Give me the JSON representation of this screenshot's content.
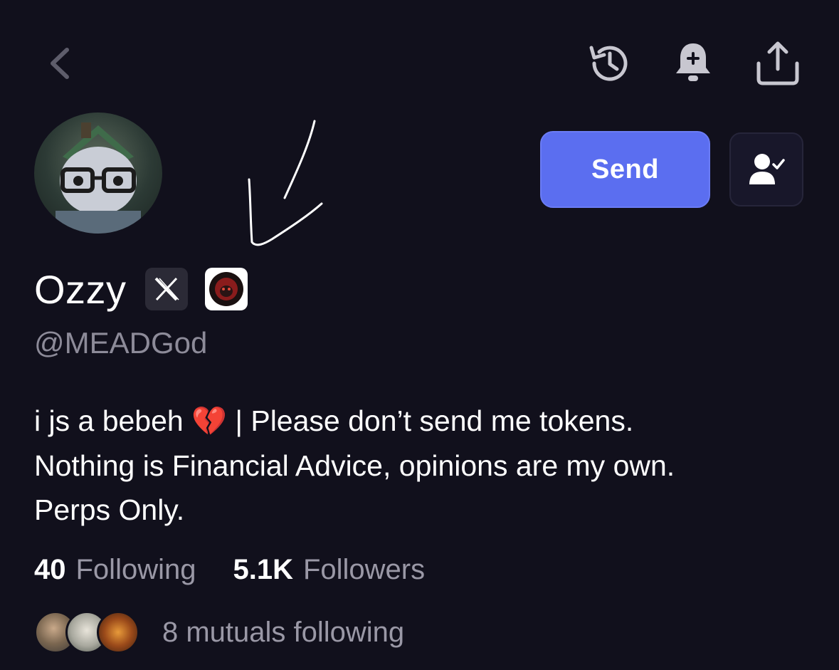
{
  "header": {
    "icons": [
      "back-chevron-icon",
      "history-icon",
      "notification-bell-plus-icon",
      "share-icon"
    ]
  },
  "actions": {
    "send_label": "Send",
    "follow_icon": "user-check-icon"
  },
  "profile": {
    "display_name": "Ozzy",
    "handle": "@MEADGod",
    "badges": [
      "x-logo-icon",
      "community-badge-icon"
    ],
    "bio_lines": [
      "i js a bebeh ",
      " | Please don’t send me tokens.",
      "Nothing is Financial Advice, opinions are my own.",
      "Perps Only."
    ],
    "bio_emoji": "💔"
  },
  "stats": {
    "following_count": "40",
    "following_label": "Following",
    "followers_count": "5.1K",
    "followers_label": "Followers"
  },
  "mutuals": {
    "text": "8 mutuals following"
  },
  "colors": {
    "background": "#11101c",
    "accent": "#5b6ef0",
    "muted_text": "#9a98a6"
  }
}
